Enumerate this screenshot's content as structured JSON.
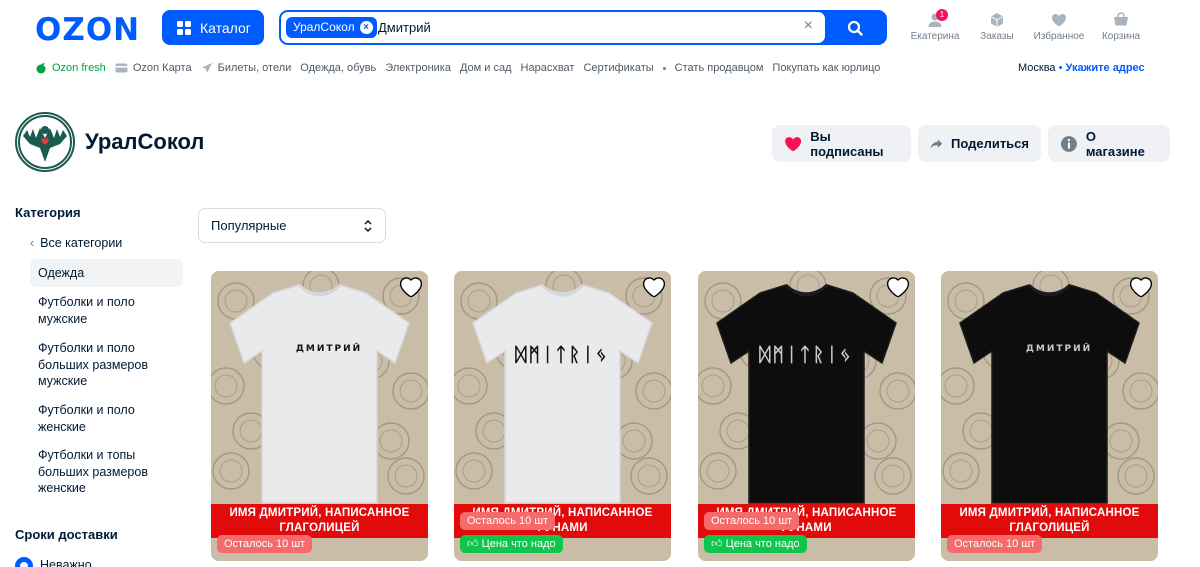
{
  "header": {
    "logo": "OZON",
    "catalog_label": "Каталог",
    "search_chip": "УралСокол",
    "search_query": "Дмитрий",
    "icons": [
      {
        "label": "Екатерина",
        "icon": "user-icon",
        "badge": "1"
      },
      {
        "label": "Заказы",
        "icon": "box-icon"
      },
      {
        "label": "Избранное",
        "icon": "heart-icon"
      },
      {
        "label": "Корзина",
        "icon": "cart-icon"
      }
    ]
  },
  "nav": {
    "items": [
      "Ozon fresh",
      "Ozon Карта",
      "Билеты, отели",
      "Одежда, обувь",
      "Электроника",
      "Дом и сад",
      "Нарасхват",
      "Сертификаты",
      "Стать продавцом",
      "Покупать как юрлицо"
    ],
    "city": "Москва",
    "address_link": "Укажите адрес"
  },
  "seller": {
    "name": "УралСокол",
    "subscribed_label": "Вы подписаны",
    "share_label": "Поделиться",
    "about_label": "О магазине"
  },
  "sidebar": {
    "category_title": "Категория",
    "all_categories": "Все категории",
    "items": [
      "Одежда",
      "Футболки и поло мужские",
      "Футболки и поло больших размеров мужские",
      "Футболки и поло женские",
      "Футболки и топы больших размеров женские"
    ],
    "delivery_title": "Сроки доставки",
    "delivery_option": "Неважно"
  },
  "sort": {
    "selected": "Популярные"
  },
  "products": [
    {
      "shirt": "white",
      "print": "ДМИТРИЙ",
      "print_style": "small",
      "banner": "ИМЯ ДМИТРИЙ, НАПИСАННОЕ ГЛАГОЛИЦЕЙ",
      "stock": "Осталось 10 шт",
      "price_badge": ""
    },
    {
      "shirt": "white",
      "print": "ᛞᛗᛁᛏᚱᛁᛃ",
      "print_style": "large",
      "banner": "ИМЯ ДМИТРИЙ, НАПИСАННОЕ РУНАМИ",
      "stock": "Осталось 10 шт",
      "price_badge": "Цена что надо"
    },
    {
      "shirt": "black",
      "print": "ᛞᛗᛁᛏᚱᛁᛃ",
      "print_style": "large",
      "banner": "ИМЯ ДМИТРИЙ, НАПИСАННОЕ РУНАМИ",
      "stock": "Осталось 10 шт",
      "price_badge": "Цена что надо"
    },
    {
      "shirt": "black",
      "print": "ДМИТРИЙ",
      "print_style": "small",
      "banner": "ИМЯ ДМИТРИЙ, НАПИСАННОЕ ГЛАГОЛИЦЕЙ",
      "stock": "Осталось 10 шт",
      "price_badge": ""
    }
  ],
  "colors": {
    "brand": "#005bff",
    "banner_red": "#e10b0b",
    "stock_tag": "#f56b6b",
    "price_tag": "#10c44c",
    "subscribed_heart": "#f91155"
  }
}
